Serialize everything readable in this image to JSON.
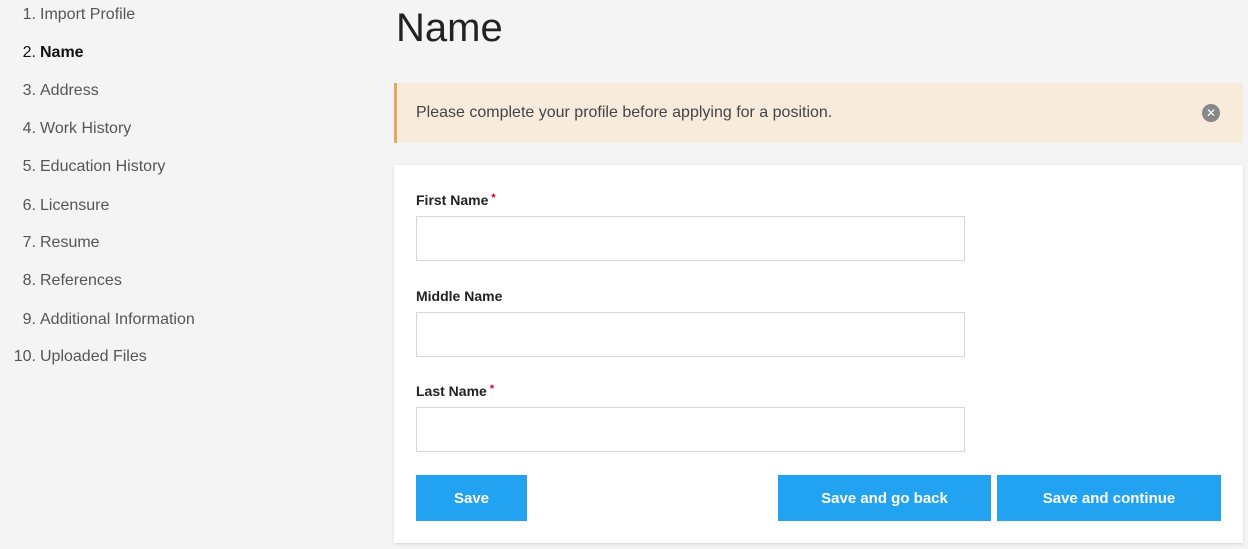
{
  "steps": [
    {
      "num": "1.",
      "label": "Import Profile"
    },
    {
      "num": "2.",
      "label": "Name"
    },
    {
      "num": "3.",
      "label": "Address"
    },
    {
      "num": "4.",
      "label": "Work History"
    },
    {
      "num": "5.",
      "label": "Education History"
    },
    {
      "num": "6.",
      "label": "Licensure"
    },
    {
      "num": "7.",
      "label": "Resume"
    },
    {
      "num": "8.",
      "label": "References"
    },
    {
      "num": "9.",
      "label": "Additional Information"
    },
    {
      "num": "10.",
      "label": "Uploaded Files"
    }
  ],
  "active_step": "Name",
  "page_title": "Name",
  "alert": {
    "message": "Please complete your profile before applying for a position.",
    "close_icon": "close-circle-icon"
  },
  "form": {
    "first_name": {
      "label": "First Name",
      "required_mark": "*",
      "value": ""
    },
    "middle_name": {
      "label": "Middle Name",
      "value": ""
    },
    "last_name": {
      "label": "Last Name",
      "required_mark": "*",
      "value": ""
    }
  },
  "buttons": {
    "save": "Save",
    "save_back": "Save and go back",
    "save_continue": "Save and continue"
  },
  "colors": {
    "accent": "#22a3f2",
    "alert_bg": "#f8ebdc",
    "alert_border": "#e0a860",
    "required": "#d0021b"
  }
}
